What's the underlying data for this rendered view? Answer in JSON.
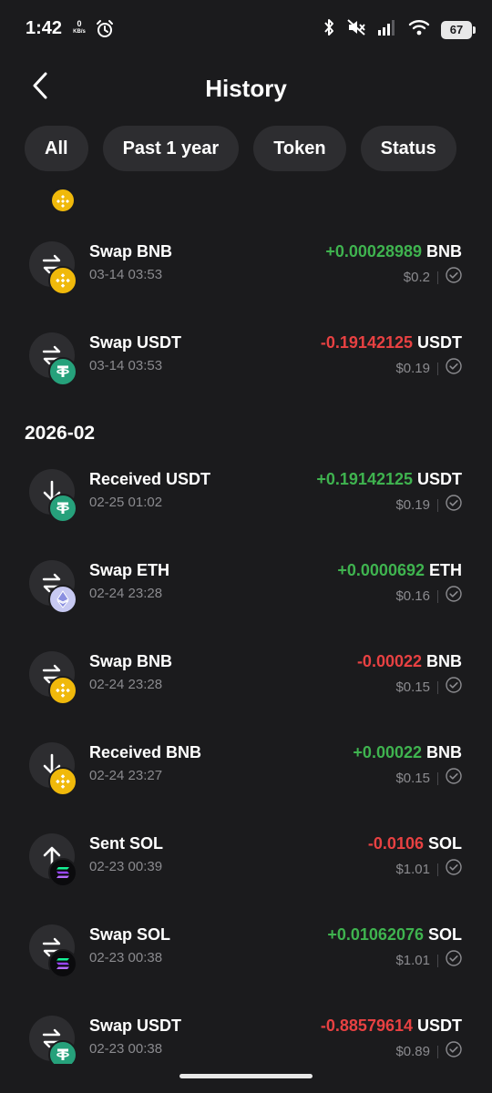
{
  "status_bar": {
    "time": "1:42",
    "net_speed": "0",
    "net_unit": "KB/s",
    "battery": "67",
    "icons": [
      "alarm-icon",
      "bluetooth-icon",
      "mute-icon",
      "signal-icon",
      "wifi-icon",
      "battery-icon"
    ]
  },
  "header": {
    "title": "History",
    "back_icon": "chevron-left-icon"
  },
  "filters": [
    "All",
    "Past 1 year",
    "Token",
    "Status"
  ],
  "colors": {
    "positive": "#3fb34f",
    "negative": "#e84142",
    "bnb": "#f0b90b",
    "usdt": "#26a17b",
    "eth": "#c7c9f2",
    "sol": "#0b0b0d"
  },
  "groups": [
    {
      "month": "",
      "transactions": [
        {
          "type": "swap",
          "title": "Swap BNB",
          "date": "03-14 03:53",
          "amount": "+0.00028989",
          "symbol": "BNB",
          "sign": "pos",
          "usd": "$0.2",
          "coin": "bnb"
        },
        {
          "type": "swap",
          "title": "Swap USDT",
          "date": "03-14 03:53",
          "amount": "-0.19142125",
          "symbol": "USDT",
          "sign": "neg",
          "usd": "$0.19",
          "coin": "usdt"
        }
      ]
    },
    {
      "month": "2026-02",
      "transactions": [
        {
          "type": "receive",
          "title": "Received USDT",
          "date": "02-25 01:02",
          "amount": "+0.19142125",
          "symbol": "USDT",
          "sign": "pos",
          "usd": "$0.19",
          "coin": "usdt"
        },
        {
          "type": "swap",
          "title": "Swap ETH",
          "date": "02-24 23:28",
          "amount": "+0.0000692",
          "symbol": "ETH",
          "sign": "pos",
          "usd": "$0.16",
          "coin": "eth"
        },
        {
          "type": "swap",
          "title": "Swap BNB",
          "date": "02-24 23:28",
          "amount": "-0.00022",
          "symbol": "BNB",
          "sign": "neg",
          "usd": "$0.15",
          "coin": "bnb"
        },
        {
          "type": "receive",
          "title": "Received BNB",
          "date": "02-24 23:27",
          "amount": "+0.00022",
          "symbol": "BNB",
          "sign": "pos",
          "usd": "$0.15",
          "coin": "bnb"
        },
        {
          "type": "send",
          "title": "Sent SOL",
          "date": "02-23 00:39",
          "amount": "-0.0106",
          "symbol": "SOL",
          "sign": "neg",
          "usd": "$1.01",
          "coin": "sol"
        },
        {
          "type": "swap",
          "title": "Swap SOL",
          "date": "02-23 00:38",
          "amount": "+0.01062076",
          "symbol": "SOL",
          "sign": "pos",
          "usd": "$1.01",
          "coin": "sol"
        },
        {
          "type": "swap",
          "title": "Swap USDT",
          "date": "02-23 00:38",
          "amount": "-0.88579614",
          "symbol": "USDT",
          "sign": "neg",
          "usd": "$0.89",
          "coin": "usdt"
        }
      ]
    }
  ]
}
